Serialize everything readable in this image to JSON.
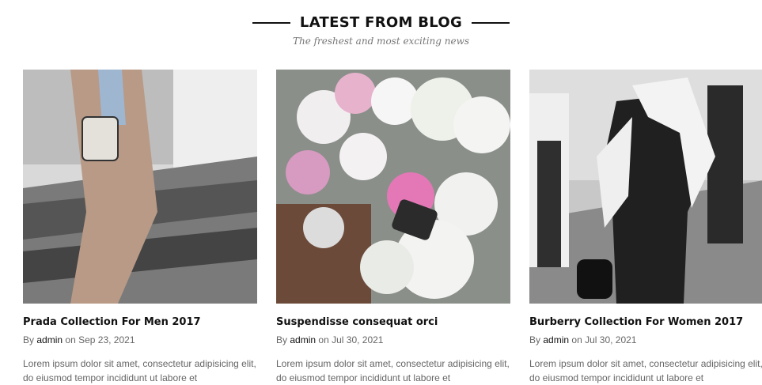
{
  "section": {
    "title": "LATEST FROM BLOG",
    "subtitle": "The freshest and most exciting news"
  },
  "posts": [
    {
      "title": "Prada Collection For Men 2017",
      "by": "By",
      "author": "admin",
      "on": "on",
      "date": "Sep 23, 2021",
      "excerpt": "Lorem ipsum dolor sit amet, consectetur adipisicing elit, do eiusmod tempor incididunt ut labore et"
    },
    {
      "title": "Suspendisse consequat orci",
      "by": "By",
      "author": "admin",
      "on": "on",
      "date": "Jul 30, 2021",
      "excerpt": "Lorem ipsum dolor sit amet, consectetur adipisicing elit, do eiusmod tempor incididunt ut labore et"
    },
    {
      "title": "Burberry Collection For Women 2017",
      "by": "By",
      "author": "admin",
      "on": "on",
      "date": "Jul 30, 2021",
      "excerpt": "Lorem ipsum dolor sit amet, consectetur adipisicing elit, do eiusmod tempor incididunt ut labore et"
    }
  ]
}
